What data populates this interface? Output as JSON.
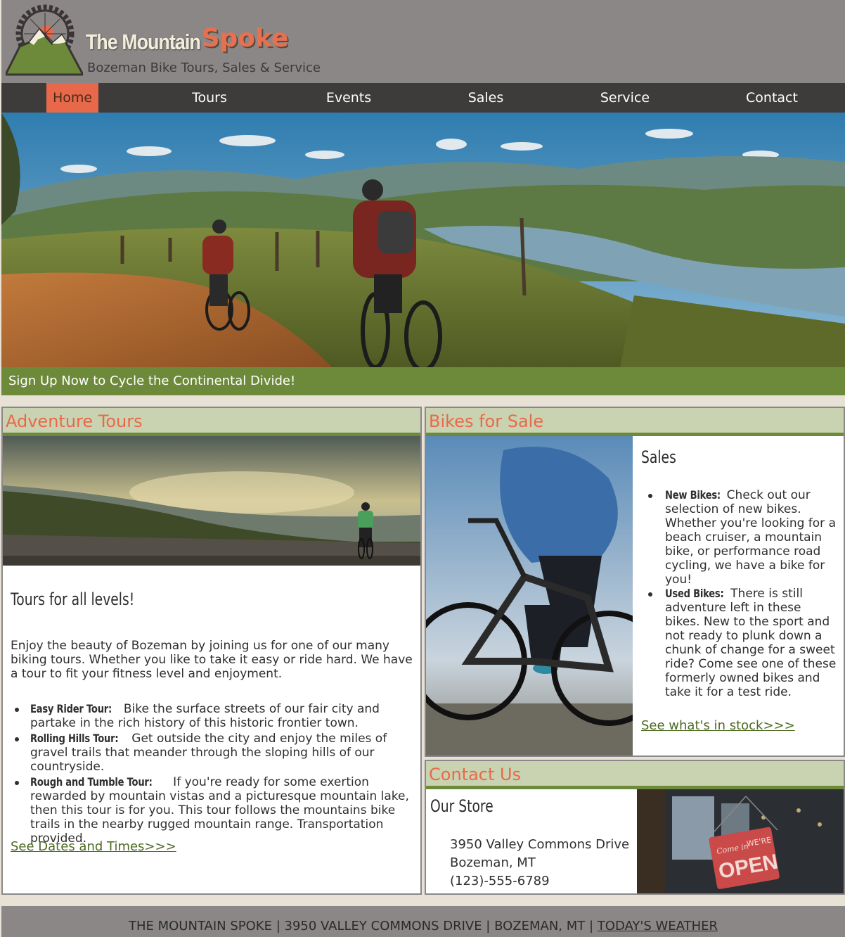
{
  "header": {
    "brand_main": "The Mountain",
    "brand_accent": "Spoke",
    "tagline": "Bozeman Bike Tours, Sales & Service",
    "logo_icon": "gear-mountain-icon"
  },
  "nav": {
    "items": [
      {
        "label": "Home",
        "active": true
      },
      {
        "label": "Tours"
      },
      {
        "label": "Events"
      },
      {
        "label": "Sales"
      },
      {
        "label": "Service"
      },
      {
        "label": "Contact"
      }
    ]
  },
  "hero": {
    "banner": "Sign Up Now to Cycle the Continental Divide!"
  },
  "tours": {
    "heading": "Adventure Tours",
    "title": "Tours for all levels!",
    "intro": "Enjoy the beauty of Bozeman by joining us for one of our many biking tours. Whether you like to take it easy or ride hard. We have a tour to fit your fitness level and enjoyment.",
    "items": [
      {
        "term": "Easy Rider Tour:",
        "text": " Bike the surface streets of our fair city and partake in the rich history of this historic frontier town."
      },
      {
        "term": "Rolling Hills Tour:",
        "text": " Get outside the city and enjoy the miles of gravel trails that meander through the sloping hills of our countryside."
      },
      {
        "term": "Rough and Tumble Tour:",
        "text": " If you're ready for some exertion rewarded by mountain vistas and a picturesque mountain lake, then this tour is for you. This tour follows the mountains bike trails in the nearby rugged mountain range. Transportation provided."
      }
    ],
    "link": "See Dates and Times>>>"
  },
  "sales": {
    "heading": "Bikes for Sale",
    "title": "Sales",
    "items": [
      {
        "term": "New Bikes:",
        "text": " Check out our selection of new bikes. Whether you're looking for a beach cruiser, a mountain bike, or performance road cycling, we have a bike for you!"
      },
      {
        "term": "Used Bikes:",
        "text": " There is still adventure left in these bikes. New to the sport and not ready to plunk down a chunk of change for a sweet ride? Come see one of these formerly owned bikes and take it for a test ride."
      }
    ],
    "link": "See what's in stock>>>"
  },
  "contact": {
    "heading": "Contact Us",
    "title": "Our Store",
    "address_line1": "3950 Valley Commons Drive",
    "address_line2": "Bozeman, MT",
    "phone": "(123)-555-6789",
    "sign_small": "Come in",
    "sign_small2": "WE'RE",
    "sign_big": "OPEN"
  },
  "footer": {
    "text": "The Mountain Spoke | 3950 Valley Commons Drive | Bozeman, MT | ",
    "weather_link": "Today's Weather"
  },
  "colors": {
    "header_bg": "#8b8787",
    "nav_bg": "#3e3b3b",
    "accent_orange": "#e8694a",
    "accent_green": "#6d8a3a",
    "panel_head_bg": "#c9d3b1",
    "page_bg": "#e7e1d6"
  }
}
